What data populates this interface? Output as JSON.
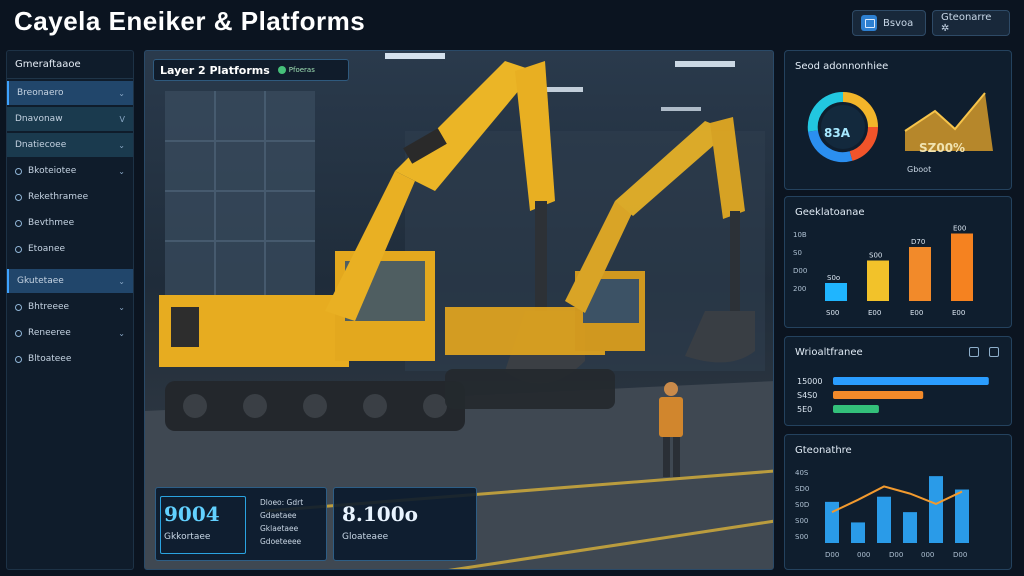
{
  "app": {
    "title": "Cayela Eneiker & Platforms",
    "top_buttons": [
      {
        "label": "Bsvoa",
        "icon": "window-icon"
      },
      {
        "label": "Gteonarre ✲"
      }
    ]
  },
  "sidebar": {
    "heading": "Gmeraftaaoe",
    "items": [
      {
        "label": "Breonaero",
        "chevron": "⌄",
        "highlight": true
      },
      {
        "label": "Dnavonaw",
        "chevron": "V",
        "highlight": false
      },
      {
        "label": "Dnatiecoee",
        "chevron": "⌄",
        "highlight": false
      },
      {
        "label": "Bkoteiotee",
        "chevron": "⌄"
      },
      {
        "label": "Rekethramee"
      },
      {
        "label": "Bevthmee"
      },
      {
        "label": "Etoanee"
      },
      {
        "label": "Gkutetaee",
        "chevron": "⌄",
        "highlight": true
      },
      {
        "label": "Bhtreeee",
        "chevron": "⌄"
      },
      {
        "label": "Reneeree",
        "chevron": "⌄"
      },
      {
        "label": "Bltoateee"
      }
    ]
  },
  "main": {
    "header": "Layer 2 Platforms",
    "header_pill": "Pfoeras",
    "cards": [
      {
        "value": "9004",
        "label": "Gkkortaee",
        "lines": [
          "Dloeo: Gdrt",
          "Gdaetaee",
          "Gklaetaee",
          "Gdoeteeee"
        ]
      },
      {
        "value": "8.100o",
        "label": "Gloateaee"
      }
    ]
  },
  "right_panels": {
    "p1": {
      "title": "Seod adonnonhiee",
      "kpi": "SZ00%",
      "kpi_sub": "Gboot",
      "donut_center": "83A"
    },
    "p2": {
      "title": "Geeklatoanae"
    },
    "p3": {
      "title": "Wrioaltfranee"
    },
    "p4": {
      "title": "Gteonathre"
    }
  },
  "chart_data": [
    {
      "type": "bar",
      "title": "Geeklatoanae",
      "categories": [
        "S00",
        "E00",
        "E00",
        "E00"
      ],
      "values": [
        4,
        9,
        12,
        15
      ],
      "data_labels": [
        "S0o",
        "S00",
        "D70",
        "E00"
      ],
      "y_tick_labels": [
        "10B",
        "S0",
        "D00",
        "200"
      ],
      "colors": [
        "#1fb5ff",
        "#f2c22a",
        "#f28a2a",
        "#f58220"
      ]
    },
    {
      "type": "bar",
      "title": "Wrioaltfranee",
      "orientation": "horizontal",
      "categories": [
        "15000",
        "S4S0",
        "5E0"
      ],
      "values": [
        0.95,
        0.55,
        0.28
      ],
      "colors": [
        "#2a9dff",
        "#f28a2a",
        "#33c07a"
      ]
    },
    {
      "type": "bar",
      "title": "Gteonathre",
      "values": [
        40,
        20,
        45,
        30,
        65,
        52
      ],
      "line_values": [
        30,
        42,
        55,
        48,
        38,
        50
      ],
      "y_tick_labels": [
        "40S",
        "SD0",
        "S0D",
        "S00",
        "S00"
      ],
      "x_tick_labels": [
        "D00",
        "000",
        "D00",
        "000",
        "D00"
      ]
    }
  ]
}
